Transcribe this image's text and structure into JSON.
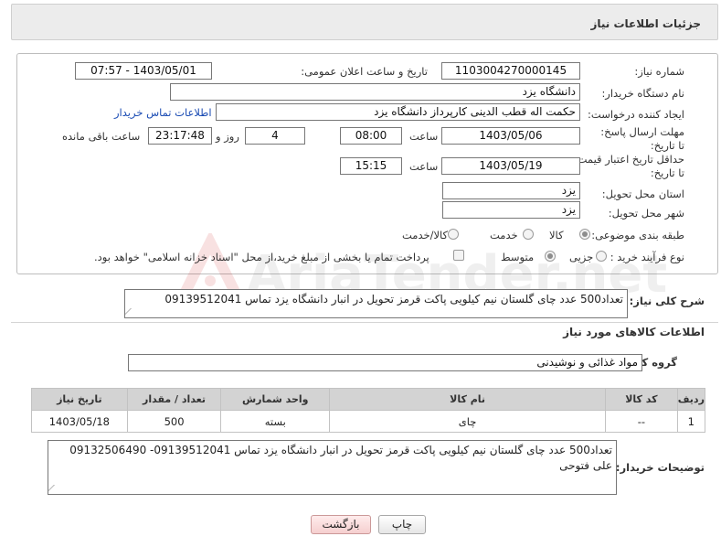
{
  "header": {
    "title": "جزئیات اطلاعات نیاز"
  },
  "form": {
    "need_number_label": "شماره نیاز:",
    "need_number": "1103004270000145",
    "announce_label": "تاریخ و ساعت اعلان عمومی:",
    "announce_value": "1403/05/01 - 07:57",
    "buyer_org_label": "نام دستگاه خریدار:",
    "buyer_org": "دانشگاه یزد",
    "requester_label": "ایجاد کننده درخواست:",
    "requester": "حکمت اله قطب الدینی کارپرداز دانشگاه یزد",
    "buyer_contact_link": "اطلاعات تماس خریدار",
    "deadline_label": "مهلت ارسال پاسخ: تا تاریخ:",
    "deadline_date": "1403/05/06",
    "time_label": "ساعت",
    "deadline_time": "08:00",
    "days_value": "4",
    "days_label": "روز و",
    "remaining_time": "23:17:48",
    "remaining_label": "ساعت باقی مانده",
    "price_validity_label": "حداقل تاریخ اعتبار قیمت: تا تاریخ:",
    "price_validity_date": "1403/05/19",
    "price_validity_time": "15:15",
    "province_label": "استان محل تحویل:",
    "province": "یزد",
    "city_label": "شهر محل تحویل:",
    "city": "یزد",
    "category_label": "طبقه بندی موضوعی:",
    "category_options": [
      "کالا",
      "خدمت",
      "کالا/خدمت"
    ],
    "purchase_type_label": "نوع فرآیند خرید :",
    "purchase_options": [
      "جزیی",
      "متوسط"
    ],
    "payment_note": "پرداخت تمام یا بخشی از مبلغ خرید،از محل \"اسناد خزانه اسلامی\" خواهد بود."
  },
  "summary": {
    "label": "شرح کلی نیاز:",
    "text": "تعداد500 عدد چای  گلستان نیم کیلویی پاکت قرمز  تحویل در انبار دانشگاه یزد تماس 09139512041"
  },
  "goods": {
    "section_title": "اطلاعات کالاهای مورد نیاز",
    "group_label": "گروه کالا:",
    "group_value": "مواد غذائی و نوشیدنی",
    "columns": [
      "ردیف",
      "کد کالا",
      "نام کالا",
      "واحد شمارش",
      "تعداد / مقدار",
      "تاریخ نیاز"
    ],
    "rows": [
      {
        "row": "1",
        "code": "--",
        "name": "چای",
        "unit": "بسته",
        "qty": "500",
        "date": "1403/05/18"
      }
    ]
  },
  "buyer_notes": {
    "label": "توضیحات خریدار:",
    "text": "تعداد500 عدد چای  گلستان نیم کیلویی پاکت قرمز  تحویل در انبار دانشگاه یزد تماس 09139512041- 09132506490 علی فتوحی"
  },
  "buttons": {
    "print": "چاپ",
    "back": "بازگشت"
  },
  "watermark": {
    "text": "AriaTender.net"
  },
  "colors": {
    "link": "#1a4bb3",
    "table_header": "#d3d3d3",
    "back_button": "#f5cfcf"
  }
}
